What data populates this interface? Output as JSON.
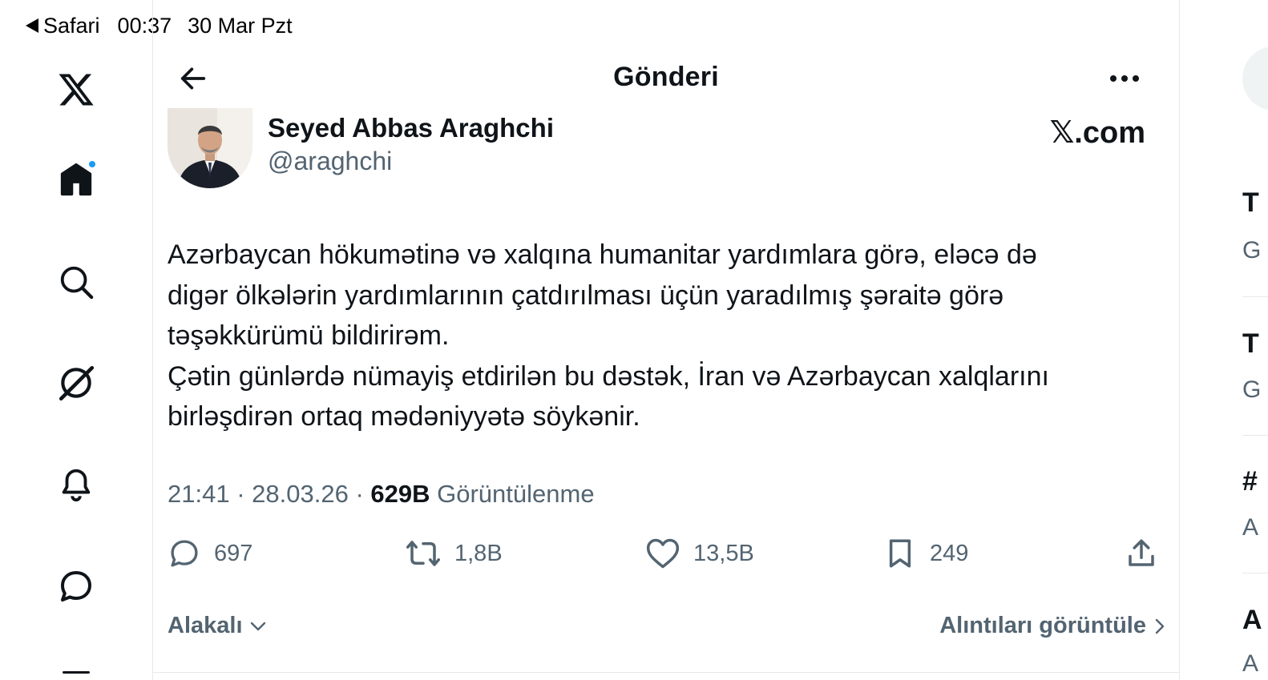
{
  "status_bar": {
    "back_app": "Safari",
    "time": "00:37",
    "date": "30 Mar Pzt"
  },
  "nav": {
    "icons": [
      "x-logo-icon",
      "home-icon",
      "search-icon",
      "grok-icon",
      "notifications-icon",
      "messages-icon"
    ],
    "home_has_badge": true,
    "badge_color": "#1d9bf0"
  },
  "header": {
    "title": "Gönderi"
  },
  "post": {
    "author_name": "Seyed Abbas Araghchi",
    "author_handle": "@araghchi",
    "source_badge": "𝕏.com",
    "text": "Azərbaycan hökumətinə və xalqına humanitar yardımlara görə, eləcə də\ndigər ölkələrin yardımlarının çatdırılması üçün yaradılmış şəraitə görə\ntəşəkkürümü bildirirəm.\nÇətin günlərdə nümayiş etdirilən bu dəstək, İran və Azərbaycan xalqlarını\nbirləşdirən ortaq mədəniyyətə söykənir.",
    "time": "21:41",
    "date": "28.03.26",
    "views_count": "629B",
    "views_label": "Görüntülenme",
    "replies": "697",
    "reposts": "1,8B",
    "likes": "13,5B",
    "bookmarks": "249"
  },
  "footer": {
    "sort_label": "Alakalı",
    "quotes_label": "Alıntıları görüntüle"
  },
  "right_peek": {
    "items": [
      "T",
      "G",
      "T",
      "G",
      "#",
      "A",
      "A",
      "A"
    ]
  },
  "colors": {
    "text_primary": "#0f1419",
    "text_secondary": "#536471",
    "border": "#e6e9eb",
    "accent": "#1d9bf0"
  }
}
